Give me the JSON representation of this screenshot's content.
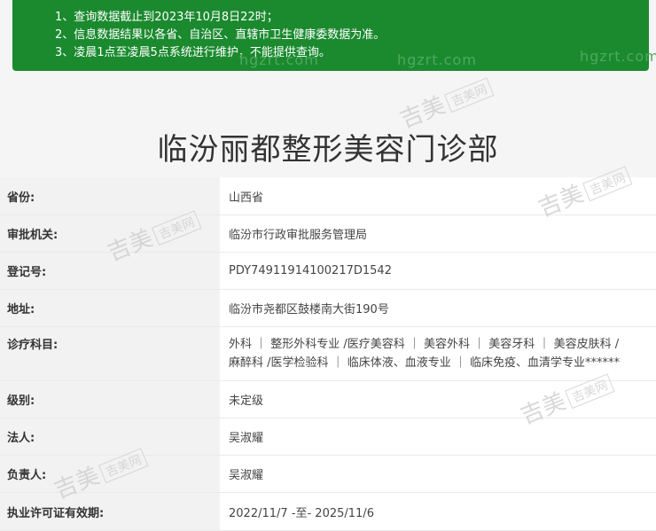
{
  "notice": {
    "lines": [
      "1、查询数据截止到2023年10月8日22时；",
      "2、信息数据结果以各省、自治区、直辖市卫生健康委数据为准。",
      "3、凌晨1点至凌晨5点系统进行维护，不能提供查询。"
    ]
  },
  "watermark": {
    "site": "hgzrt.com",
    "brand": "吉美",
    "brand_box": "吉美网"
  },
  "title": "临汾丽都整形美容门诊部",
  "rows": [
    {
      "label": "省份:",
      "value": "山西省"
    },
    {
      "label": "审批机关:",
      "value": "临汾市行政审批服务管理局"
    },
    {
      "label": "登记号:",
      "value": "PDY74911914100217D1542"
    },
    {
      "label": "地址:",
      "value": "临汾市尧都区鼓楼南大街190号"
    },
    {
      "label": "诊疗科目:",
      "value_line1": "外科 ｜ 整形外科专业 /医疗美容科 ｜ 美容外科 ｜ 美容牙科 ｜ 美容皮肤科 /",
      "value_line2": "麻醉科 /医学检验科 ｜ 临床体液、血液专业 ｜ 临床免疫、血清学专业******"
    },
    {
      "label": "级别:",
      "value": "未定级"
    },
    {
      "label": "法人:",
      "value": "吴淑耀"
    },
    {
      "label": "负责人:",
      "value": "吴淑耀"
    },
    {
      "label": "执业许可证有效期:",
      "value": "2022/11/7 -至- 2025/11/6"
    }
  ]
}
